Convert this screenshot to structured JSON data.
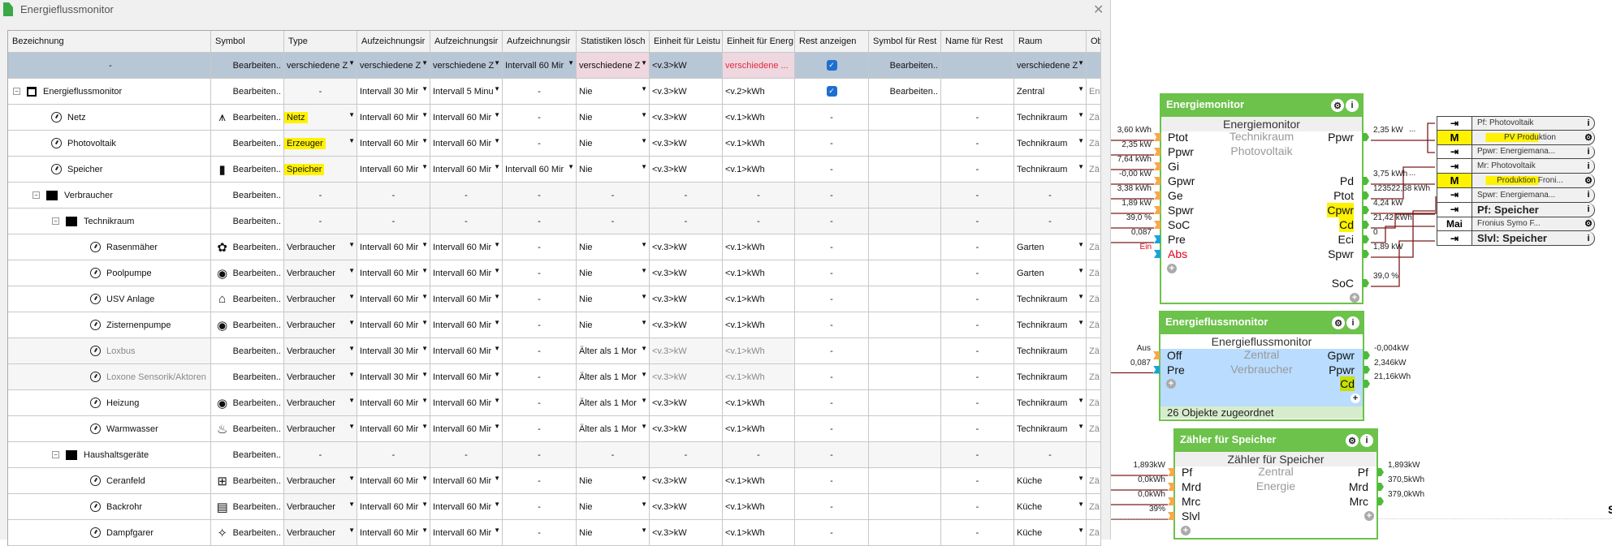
{
  "window": {
    "title": "Energieflussmonitor",
    "close_icon": "close-icon"
  },
  "table": {
    "headers": [
      "Bezeichnung",
      "Symbol",
      "Type",
      "Aufzeichnungsir",
      "Aufzeichnungsir",
      "Aufzeichnungsir",
      "Statistiken lösch",
      "Einheit für Leistu",
      "Einheit für Energ",
      "Rest anzeigen",
      "Symbol für Rest",
      "Name für Rest",
      "Raum",
      "Ob"
    ],
    "rows": [
      {
        "kind": "selected",
        "level": 0,
        "name": "-",
        "icon": "",
        "sym_icon": "",
        "cells": [
          "Bearbeiten..",
          "verschiedene Z",
          "verschiedene Z",
          "verschiedene Z",
          "Intervall 60 Mir",
          "verschiedene Z",
          "<v.3>kW",
          "verschiedene ...",
          true,
          "Bearbeiten..",
          "",
          "verschiedene Z",
          ""
        ],
        "dd": [
          1,
          2,
          3,
          4,
          5,
          11
        ]
      },
      {
        "kind": "group",
        "level": 0,
        "name": "Energieflussmonitor",
        "icon": "window-icon",
        "sym_icon": "",
        "cells": [
          "Bearbeiten..",
          "-",
          "Intervall 30 Mir",
          "Intervall 5 Minu",
          "-",
          "Nie",
          "<v.3>kW",
          "<v.2>kWh",
          true,
          "Bearbeiten..",
          "",
          "Zentral",
          "Ene"
        ],
        "dd": [
          2,
          3,
          5,
          11
        ]
      },
      {
        "kind": "item",
        "level": 1,
        "name": "Netz",
        "icon": "gauge-icon",
        "sym_icon": "power-tower-icon",
        "type_highlight": true,
        "cells": [
          "Bearbeiten..",
          "Netz",
          "Intervall 60 Mir",
          "Intervall 60 Mir",
          "-",
          "Nie",
          "<v.3>kW",
          "<v.1>kWh",
          "-",
          "",
          "-",
          "Technikraum",
          "Zä"
        ],
        "dd": [
          1,
          2,
          3,
          5,
          11
        ]
      },
      {
        "kind": "item",
        "level": 1,
        "name": "Photovoltaik",
        "icon": "gauge-icon",
        "sym_icon": "",
        "type_highlight": true,
        "cells": [
          "Bearbeiten..",
          "Erzeuger",
          "Intervall 60 Mir",
          "Intervall 60 Mir",
          "-",
          "Nie",
          "<v.3>kW",
          "<v.1>kWh",
          "-",
          "",
          "-",
          "Technikraum",
          "Zä"
        ],
        "dd": [
          1,
          2,
          3,
          5,
          11
        ]
      },
      {
        "kind": "item",
        "level": 1,
        "name": "Speicher",
        "icon": "gauge-icon",
        "sym_icon": "battery-plug-icon",
        "type_highlight": true,
        "cells": [
          "Bearbeiten..",
          "Speicher",
          "Intervall 60 Mir",
          "Intervall 60 Mir",
          "Intervall 60 Mir",
          "Nie",
          "<v.3>kW",
          "<v.1>kWh",
          "-",
          "",
          "-",
          "Technikraum",
          "Zä"
        ],
        "dd": [
          2,
          3,
          4,
          5,
          11
        ]
      },
      {
        "kind": "folder",
        "level": 1,
        "name": "Verbraucher",
        "icon": "folder-icon",
        "sym_icon": "",
        "cells": [
          "Bearbeiten..",
          "-",
          "-",
          "-",
          "-",
          "-",
          "-",
          "-",
          "-",
          "",
          "-",
          "-",
          ""
        ],
        "dd": []
      },
      {
        "kind": "folder",
        "level": 2,
        "name": "Technikraum",
        "icon": "folder-icon",
        "sym_icon": "",
        "cells": [
          "Bearbeiten..",
          "-",
          "-",
          "-",
          "-",
          "-",
          "-",
          "-",
          "-",
          "",
          "-",
          "-",
          ""
        ],
        "dd": []
      },
      {
        "kind": "item",
        "level": 3,
        "name": "Rasenmäher",
        "icon": "gauge-icon",
        "sym_icon": "flower-icon",
        "cells": [
          "Bearbeiten..",
          "Verbraucher",
          "Intervall 60 Mir",
          "Intervall 60 Mir",
          "-",
          "Nie",
          "<v.3>kW",
          "<v.1>kWh",
          "-",
          "",
          "-",
          "Garten",
          "Zä"
        ],
        "dd": [
          1,
          2,
          3,
          5,
          11
        ]
      },
      {
        "kind": "item",
        "level": 3,
        "name": "Poolpumpe",
        "icon": "gauge-icon",
        "sym_icon": "pump-icon",
        "cells": [
          "Bearbeiten..",
          "Verbraucher",
          "Intervall 60 Mir",
          "Intervall 60 Mir",
          "-",
          "Nie",
          "<v.3>kW",
          "<v.1>kWh",
          "-",
          "",
          "-",
          "Garten",
          "Zä"
        ],
        "dd": [
          1,
          2,
          3,
          5,
          11
        ]
      },
      {
        "kind": "item",
        "level": 3,
        "name": "USV Anlage",
        "icon": "gauge-icon",
        "sym_icon": "house-icon",
        "cells": [
          "Bearbeiten..",
          "Verbraucher",
          "Intervall 60 Mir",
          "Intervall 60 Mir",
          "-",
          "Nie",
          "<v.3>kW",
          "<v.1>kWh",
          "-",
          "",
          "-",
          "Technikraum",
          "Zä"
        ],
        "dd": [
          1,
          2,
          3,
          5,
          11
        ]
      },
      {
        "kind": "item",
        "level": 3,
        "name": "Zisternenpumpe",
        "icon": "gauge-icon",
        "sym_icon": "pump-icon",
        "cells": [
          "Bearbeiten..",
          "Verbraucher",
          "Intervall 60 Mir",
          "Intervall 60 Mir",
          "-",
          "Nie",
          "<v.3>kW",
          "<v.1>kWh",
          "-",
          "",
          "-",
          "Technikraum",
          "Zä"
        ],
        "dd": [
          1,
          2,
          3,
          5,
          11
        ]
      },
      {
        "kind": "item",
        "level": 3,
        "name": "Loxbus",
        "muted": true,
        "icon": "gauge-icon",
        "sym_icon": "",
        "cells": [
          "Bearbeiten..",
          "Verbraucher",
          "Intervall 30 Mir",
          "Intervall 60 Mir",
          "-",
          "Älter als 1 Mor",
          "<v.3>kW",
          "<v.1>kWh",
          "-",
          "",
          "-",
          "Technikraum",
          "Zä"
        ],
        "dd": [
          1,
          2,
          3,
          5
        ]
      },
      {
        "kind": "item",
        "level": 3,
        "name": "Loxone Sensorik/Aktoren",
        "muted": true,
        "icon": "gauge-icon",
        "sym_icon": "",
        "cells": [
          "Bearbeiten..",
          "Verbraucher",
          "Intervall 30 Mir",
          "Intervall 60 Mir",
          "-",
          "Älter als 1 Mor",
          "<v.3>kW",
          "<v.1>kWh",
          "-",
          "",
          "-",
          "Technikraum",
          "Zä"
        ],
        "dd": [
          1,
          2,
          3,
          5
        ]
      },
      {
        "kind": "item",
        "level": 3,
        "name": "Heizung",
        "icon": "gauge-icon",
        "sym_icon": "pump-icon",
        "cells": [
          "Bearbeiten..",
          "Verbraucher",
          "Intervall 60 Mir",
          "Intervall 60 Mir",
          "-",
          "Älter als 1 Mor",
          "<v.3>kW",
          "<v.1>kWh",
          "-",
          "",
          "-",
          "Technikraum",
          "Zä"
        ],
        "dd": [
          1,
          2,
          3,
          5,
          11
        ]
      },
      {
        "kind": "item",
        "level": 3,
        "name": "Warmwasser",
        "icon": "gauge-icon",
        "sym_icon": "hot-water-icon",
        "cells": [
          "Bearbeiten..",
          "Verbraucher",
          "Intervall 60 Mir",
          "Intervall 60 Mir",
          "-",
          "Älter als 1 Mor",
          "<v.3>kW",
          "<v.1>kWh",
          "-",
          "",
          "-",
          "Technikraum",
          "Zä"
        ],
        "dd": [
          1,
          2,
          3,
          5,
          11
        ]
      },
      {
        "kind": "folder",
        "level": 2,
        "name": "Haushaltsgeräte",
        "icon": "folder-icon",
        "sym_icon": "",
        "cells": [
          "Bearbeiten..",
          "-",
          "-",
          "-",
          "-",
          "-",
          "-",
          "-",
          "-",
          "",
          "-",
          "-",
          ""
        ],
        "dd": []
      },
      {
        "kind": "item",
        "level": 3,
        "name": "Ceranfeld",
        "icon": "gauge-icon",
        "sym_icon": "cooktop-icon",
        "cells": [
          "Bearbeiten..",
          "Verbraucher",
          "Intervall 60 Mir",
          "Intervall 60 Mir",
          "-",
          "Nie",
          "<v.3>kW",
          "<v.1>kWh",
          "-",
          "",
          "-",
          "Küche",
          "Zä"
        ],
        "dd": [
          1,
          2,
          3,
          5,
          11
        ]
      },
      {
        "kind": "item",
        "level": 3,
        "name": "Backrohr",
        "icon": "gauge-icon",
        "sym_icon": "oven-icon",
        "cells": [
          "Bearbeiten..",
          "Verbraucher",
          "Intervall 60 Mir",
          "Intervall 60 Mir",
          "-",
          "Nie",
          "<v.3>kW",
          "<v.1>kWh",
          "-",
          "",
          "-",
          "Küche",
          "Zä"
        ],
        "dd": [
          1,
          2,
          3,
          5,
          11
        ]
      },
      {
        "kind": "item",
        "level": 3,
        "name": "Dampfgarer",
        "icon": "gauge-icon",
        "sym_icon": "steam-icon",
        "cells": [
          "Bearbeiten..",
          "Verbraucher",
          "Intervall 60 Mir",
          "Intervall 60 Mir",
          "-",
          "Nie",
          "<v.3>kW",
          "<v.1>kWh",
          "-",
          "",
          "-",
          "Küche",
          "Zä"
        ],
        "dd": [
          1,
          2,
          3,
          5,
          11
        ]
      }
    ]
  },
  "diagram": {
    "energiemonitor": {
      "title": "Energiemonitor",
      "subtitle": "Energiemonitor",
      "center": [
        "Technikraum",
        "Photovoltaik"
      ],
      "inputs": [
        {
          "label": "Ptot",
          "value": "3,60 kWh",
          "kind": "orange"
        },
        {
          "label": "Ppwr",
          "value": "2,35 kW",
          "kind": "orange"
        },
        {
          "label": "Gi",
          "value": "7,64 kWh",
          "kind": "orange"
        },
        {
          "label": "Gpwr",
          "value": "-0,00 kW",
          "kind": "orange"
        },
        {
          "label": "Ge",
          "value": "3,38 kWh",
          "kind": "orange"
        },
        {
          "label": "Spwr",
          "value": "1,89 kW",
          "kind": "orange"
        },
        {
          "label": "SoC",
          "value": "39,0 %",
          "kind": "orange"
        },
        {
          "label": "Pre",
          "value": "0,087",
          "kind": "blue"
        },
        {
          "label": "Abs",
          "value": "Ein",
          "kind": "blue",
          "red": true
        }
      ],
      "outputs": [
        {
          "label": "Ppwr",
          "value": "2,35 kW",
          "more": "..."
        },
        {
          "label": "Pd",
          "value": "3,75 kWh",
          "more": "..."
        },
        {
          "label": "Ptot",
          "value": "123522,68 kWh"
        },
        {
          "label": "Cpwr",
          "value": "4,24 kW",
          "highlight": true
        },
        {
          "label": "Cd",
          "value": "21,42 kWh",
          "highlight": true
        },
        {
          "label": "Eci",
          "value": "0"
        },
        {
          "label": "Spwr",
          "value": "1,89 kW"
        },
        {
          "label": "SoC",
          "value": "39,0 %"
        }
      ]
    },
    "objects": [
      {
        "badge": "",
        "icon": "input-icon",
        "label": "Pf: Photovoltaik",
        "end": "i"
      },
      {
        "badge": "M",
        "icon": "",
        "label": "PV Produktion",
        "end": "gear",
        "highlight": true
      },
      {
        "badge": "",
        "icon": "input-icon",
        "label": "Ppwr: Energiemana...",
        "end": "i"
      },
      {
        "badge": "",
        "icon": "input-icon",
        "label": "Mr: Photovoltaik",
        "end": "i"
      },
      {
        "badge": "M",
        "icon": "",
        "label": "Produktion Froni...",
        "end": "gear",
        "highlight": true
      },
      {
        "badge": "",
        "icon": "input-icon",
        "label": "Spwr: Energiemana...",
        "end": "i"
      },
      {
        "badge": "",
        "icon": "input-icon",
        "label": "Pf: Speicher",
        "end": "i",
        "big": true
      },
      {
        "badge": "Mai",
        "icon": "",
        "label": "Fronius Symo F...",
        "end": "gear"
      },
      {
        "badge": "",
        "icon": "input-icon",
        "label": "Slvl: Speicher",
        "end": "i",
        "big": true
      }
    ],
    "energieflussmonitor": {
      "title": "Energieflussmonitor",
      "subtitle": "Energieflussmonitor",
      "center": [
        "Zentral",
        "Verbraucher"
      ],
      "inputs": [
        {
          "label": "Off",
          "value": "Aus",
          "kind": "orange"
        },
        {
          "label": "Pre",
          "value": "0,087",
          "kind": "blue"
        }
      ],
      "outputs": [
        {
          "label": "Gpwr",
          "value": "-0,004kW"
        },
        {
          "label": "Ppwr",
          "value": "2,346kW"
        },
        {
          "label": "Cd",
          "value": "21,16kWh",
          "highlight": true
        }
      ],
      "footer": "26 Objekte zugeordnet"
    },
    "zaehler": {
      "title": "Zähler für Speicher",
      "subtitle": "Zähler für Speicher",
      "center": [
        "Zentral",
        "Energie"
      ],
      "inputs": [
        {
          "label": "Pf",
          "value": "1,893kW",
          "kind": "orange"
        },
        {
          "label": "Mrd",
          "value": "0,0kWh",
          "kind": "orange"
        },
        {
          "label": "Mrc",
          "value": "0,0kWh",
          "kind": "orange"
        },
        {
          "label": "Slvl",
          "value": "39%",
          "kind": "orange"
        }
      ],
      "outputs": [
        {
          "label": "Pf",
          "value": "1,893kW"
        },
        {
          "label": "Mrd",
          "value": "370,5kWh"
        },
        {
          "label": "Mrc",
          "value": "379,0kWh"
        }
      ]
    },
    "edge_text": "S"
  },
  "colors": {
    "block_green": "#6cc24a",
    "wire": "#7b1a1a",
    "highlight": "#fff200",
    "selected_row": "#b8c7d6"
  }
}
